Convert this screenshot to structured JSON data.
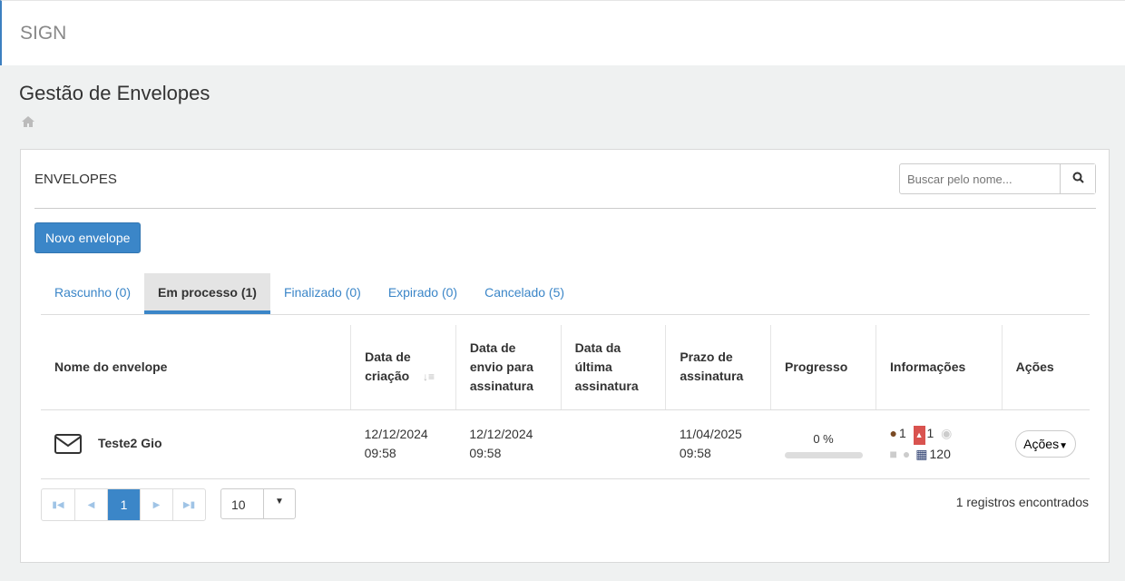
{
  "header": {
    "brand": "SIGN"
  },
  "page": {
    "title": "Gestão de Envelopes"
  },
  "panel": {
    "title": "ENVELOPES",
    "search_placeholder": "Buscar pelo nome...",
    "new_button": "Novo envelope"
  },
  "tabs": [
    {
      "label": "Rascunho (0)"
    },
    {
      "label": "Em processo (1)",
      "active": true
    },
    {
      "label": "Finalizado (0)"
    },
    {
      "label": "Expirado (0)"
    },
    {
      "label": "Cancelado (5)"
    }
  ],
  "table": {
    "headers": [
      "Nome do envelope",
      "Data de criação",
      "Data de envio para assinatura",
      "Data da última assinatura",
      "Prazo de assinatura",
      "Progresso",
      "Informações",
      "Ações"
    ],
    "rows": [
      {
        "name": "Teste2 Gio",
        "created": "12/12/2024 09:58",
        "sent": "12/12/2024 09:58",
        "last_signature": "",
        "deadline": "11/04/2025 09:58",
        "progress_label": "0 %",
        "progress": 0,
        "signers": "1",
        "documents": "1",
        "days": "120",
        "actions": "Ações"
      }
    ]
  },
  "pagination": {
    "current": "1",
    "page_size": "10",
    "count_text": "1 registros encontrados"
  },
  "colors": {
    "accent": "#3b86c8"
  }
}
